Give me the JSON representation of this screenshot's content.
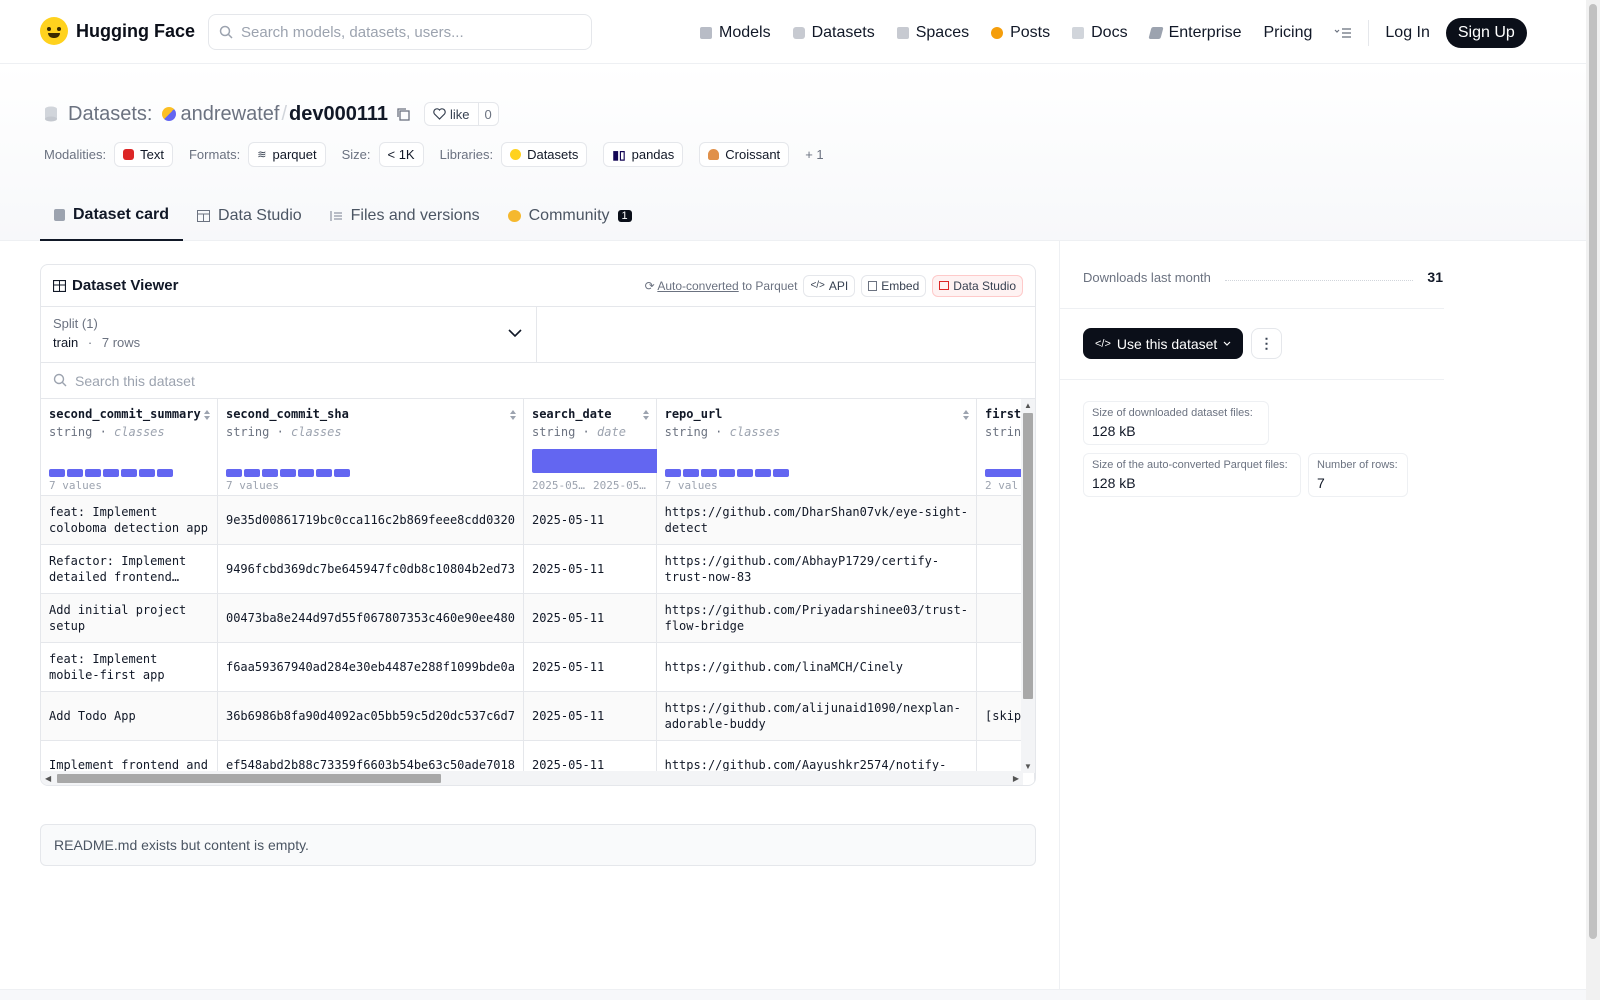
{
  "nav": {
    "brand": "Hugging Face",
    "search_placeholder": "Search models, datasets, users...",
    "items": [
      {
        "label": "Models",
        "color": "#9ca3af"
      },
      {
        "label": "Datasets",
        "color": "#9ca3af"
      },
      {
        "label": "Spaces",
        "color": "#9ca3af"
      },
      {
        "label": "Posts",
        "color": "#f59e0b"
      },
      {
        "label": "Docs",
        "color": "#9ca3af"
      },
      {
        "label": "Enterprise",
        "color": "#9ca3af"
      },
      {
        "label": "Pricing"
      }
    ],
    "login": "Log In",
    "signup": "Sign Up"
  },
  "header": {
    "section": "Datasets:",
    "owner": "andrewatef",
    "slash": "/",
    "repo": "dev000111",
    "like_label": "like",
    "like_count": "0",
    "modalities_label": "Modalities:",
    "modality": "Text",
    "formats_label": "Formats:",
    "format": "parquet",
    "size_label": "Size:",
    "size": "< 1K",
    "libraries_label": "Libraries:",
    "libraries": [
      "Datasets",
      "pandas",
      "Croissant"
    ],
    "more_libraries": "+ 1"
  },
  "tabs": [
    {
      "label": "Dataset card"
    },
    {
      "label": "Data Studio"
    },
    {
      "label": "Files and versions"
    },
    {
      "label": "Community",
      "badge": "1"
    }
  ],
  "viewer": {
    "title": "Dataset Viewer",
    "auto_converted": "Auto-converted",
    "to_parquet": "to Parquet",
    "api": "API",
    "embed": "Embed",
    "data_studio": "Data Studio",
    "split_label": "Split (1)",
    "split_name": "train",
    "split_sep": "·",
    "split_rows": "7 rows",
    "search_placeholder": "Search this dataset",
    "columns": [
      {
        "name": "second_commit_summary",
        "type": "string",
        "kind": "classes",
        "count": "7 values"
      },
      {
        "name": "second_commit_sha",
        "type": "string",
        "kind": "classes",
        "count": "7 values"
      },
      {
        "name": "search_date",
        "type": "string",
        "kind": "date",
        "date_min": "2025-05…",
        "date_max": "2025-05…"
      },
      {
        "name": "repo_url",
        "type": "string",
        "kind": "classes",
        "count": "7 values"
      },
      {
        "name": "first",
        "type": "strin",
        "kind": "",
        "count": "2 val"
      }
    ],
    "rows": [
      [
        "feat: Implement coloboma detection app",
        "9e35d00861719bc0cca116c2b869feee8cdd0320",
        "2025-05-11",
        "https://github.com/DharShan07vk/eye-sight-detect",
        ""
      ],
      [
        "Refactor: Implement detailed frontend…",
        "9496fcbd369dc7be645947fc0db8c10804b2ed73",
        "2025-05-11",
        "https://github.com/AbhayP1729/certify-trust-now-83",
        ""
      ],
      [
        "Add initial project setup",
        "00473ba8e244d97d55f067807353c460e90ee480",
        "2025-05-11",
        "https://github.com/Priyadarshinee03/trust-flow-bridge",
        ""
      ],
      [
        "feat: Implement mobile-first app",
        "f6aa59367940ad284e30eb4487e288f1099bde0a",
        "2025-05-11",
        "https://github.com/linaMCH/Cinely",
        ""
      ],
      [
        "Add Todo App",
        "36b6986b8fa90d4092ac05bb59c5d20dc537c6d7",
        "2025-05-11",
        "https://github.com/alijunaid1090/nexplan-adorable-buddy",
        "[skip"
      ],
      [
        "Implement frontend and",
        "ef548abd2b88c73359f6603b54be63c50ade7018",
        "2025-05-11",
        "https://github.com/Aayushkr2574/notify-",
        ""
      ]
    ]
  },
  "readme": "README.md exists but content is empty.",
  "sidebar": {
    "downloads_label": "Downloads last month",
    "downloads": "31",
    "use_dataset": "Use this dataset",
    "more": "⋮",
    "stats": [
      {
        "label": "Size of downloaded dataset files:",
        "value": "128 kB"
      },
      {
        "label": "Size of the auto-converted Parquet files:",
        "value": "128 kB"
      },
      {
        "label": "Number of rows:",
        "value": "7"
      }
    ]
  }
}
